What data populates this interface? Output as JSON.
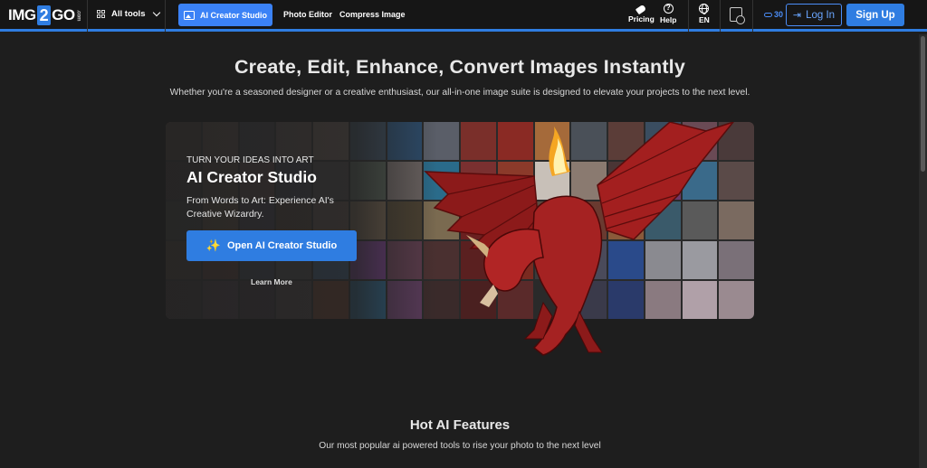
{
  "header": {
    "logo": {
      "prefix": "IMG",
      "number": "2",
      "suffix": "GO",
      "tld": ".com"
    },
    "all_tools_label": "All tools",
    "nav": [
      {
        "label": "AI Creator Studio",
        "active": true
      },
      {
        "label": "Photo Editor",
        "active": false
      },
      {
        "label": "Compress Image",
        "active": false
      }
    ],
    "pricing_label": "Pricing",
    "help_label": "Help",
    "language_label": "EN",
    "credits_count": "30",
    "login_label": "Log In",
    "signup_label": "Sign Up"
  },
  "hero": {
    "title": "Create, Edit, Enhance, Convert Images Instantly",
    "subtitle": "Whether you're a seasoned designer or a creative enthusiast, our all-in-one image suite is designed to elevate your projects to the next level."
  },
  "banner": {
    "eyebrow": "TURN YOUR IDEAS INTO ART",
    "title": "AI Creator Studio",
    "description": "From Words to Art: Experience AI's Creative Wizardry.",
    "cta_label": "Open AI Creator Studio",
    "learn_more_label": "Learn More"
  },
  "features": {
    "title": "Hot AI Features",
    "subtitle": "Our most popular ai powered tools to rise your photo to the next level"
  },
  "colors": {
    "accent": "#2f7de1",
    "background": "#1e1e1e",
    "header_bg": "#161616"
  }
}
